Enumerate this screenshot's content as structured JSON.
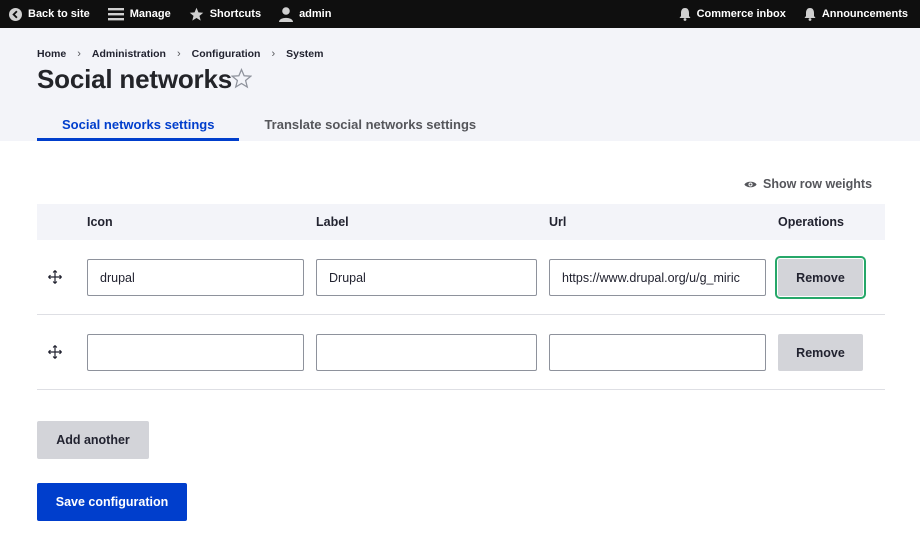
{
  "toolbar": {
    "back_to_site": "Back to site",
    "manage": "Manage",
    "shortcuts": "Shortcuts",
    "user": "admin",
    "commerce_inbox": "Commerce inbox",
    "announcements": "Announcements"
  },
  "breadcrumb": [
    "Home",
    "Administration",
    "Configuration",
    "System"
  ],
  "page": {
    "title": "Social networks",
    "tabs": [
      {
        "label": "Social networks settings",
        "active": true
      },
      {
        "label": "Translate social networks settings",
        "active": false
      }
    ]
  },
  "table": {
    "show_row_weights": "Show row weights",
    "headers": [
      "Icon",
      "Label",
      "Url",
      "Operations"
    ],
    "rows": [
      {
        "icon": "drupal",
        "label": "Drupal",
        "url": "https://www.drupal.org/u/g_miric",
        "remove": "Remove"
      },
      {
        "icon": "",
        "label": "",
        "url": "",
        "remove": "Remove"
      }
    ]
  },
  "actions": {
    "add_another": "Add another",
    "save": "Save configuration"
  },
  "colors": {
    "primary": "#003ecc",
    "focus": "#26a769",
    "toolbar_bg": "#0f0f0f"
  }
}
